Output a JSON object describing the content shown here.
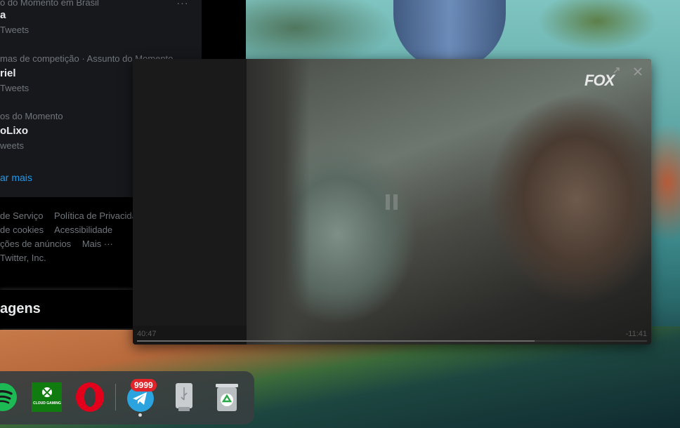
{
  "twitter": {
    "trends": [
      {
        "context": "o do Momento em Brasil",
        "name": "a",
        "count": "Tweets"
      },
      {
        "context": "mas de competição · Assunto do Momento",
        "name": "riel",
        "count": "Tweets"
      },
      {
        "context": "os do Momento",
        "name": "oLixo",
        "count": "weets"
      }
    ],
    "more_icon": "···",
    "show_more": "ar mais",
    "footer": {
      "row1": [
        "de Serviço",
        "Política de Privacidade"
      ],
      "row2": [
        "de cookies",
        "Acessibilidade"
      ],
      "row3": [
        "ções de anúncios",
        "Mais ···"
      ],
      "row4": [
        "Twitter, Inc."
      ]
    },
    "messages": {
      "title": "agens",
      "new_message_icon": "new-message-icon",
      "collapse_icon": "chevron-up-double-icon"
    }
  },
  "video_player": {
    "channel_logo": "FOX",
    "time_elapsed": "40:47",
    "time_remaining": "-11:41",
    "progress_fraction": 0.78,
    "state": "paused"
  },
  "dock": {
    "apps": [
      "Spotify",
      "Xbox Cloud Gaming",
      "Opera",
      "Telegram",
      "USB Drive",
      "Recycle Bin"
    ],
    "xbox_label": "CLOUD GAMING",
    "telegram_badge": "9999"
  },
  "colors": {
    "twitter_blue": "#1d9bf0",
    "badge_red": "#e0242a",
    "spotify_green": "#1db954",
    "xbox_green": "#107c10",
    "opera_red": "#e3001b",
    "telegram_blue": "#2aa3df"
  }
}
